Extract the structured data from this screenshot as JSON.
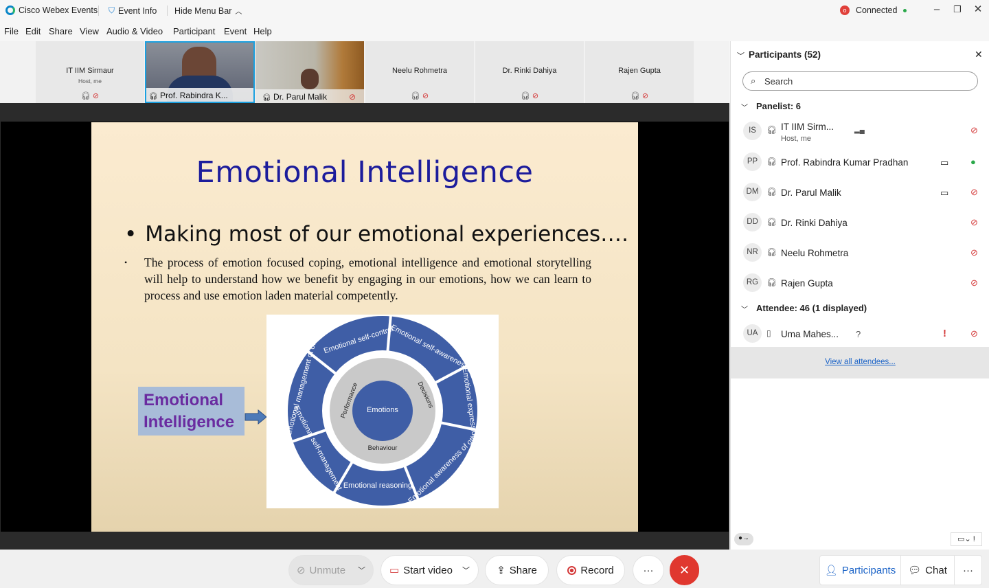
{
  "titlebar": {
    "app_name": "Cisco Webex Events",
    "event_info": "Event Info",
    "hide_menu": "Hide Menu Bar",
    "status": "Connected"
  },
  "menu": [
    "File",
    "Edit",
    "Share",
    "View",
    "Audio & Video",
    "Participant",
    "Event",
    "Help"
  ],
  "strip": {
    "tiles": [
      {
        "name": "IT IIM Sirmaur",
        "sub": "Host, me"
      },
      {
        "name": "Prof. Rabindra K..."
      },
      {
        "name": "Dr. Parul Malik"
      },
      {
        "name": "Neelu Rohmetra"
      },
      {
        "name": "Dr. Rinki Dahiya"
      },
      {
        "name": "Rajen Gupta"
      }
    ]
  },
  "slide": {
    "title": "Emotional Intelligence",
    "bullet1": "Making most of our emotional experiences….",
    "bullet2": "The process of emotion focused coping, emotional intelligence and emotional storytelling will help to understand how we benefit by engaging in our emotions, how we can learn to process and use emotion laden material competently.",
    "box_line1": "Emotional",
    "box_line2": "Intelligence",
    "diagram": {
      "center": "Emotions",
      "inner": [
        "Performance",
        "Decisions",
        "Behaviour"
      ],
      "segments": [
        "Emotional self-control",
        "Emotional self-awareness",
        "Emotional expression",
        "Emotional awareness of others",
        "Emotional reasoning",
        "Emotional self-management",
        "Emotional management of others"
      ]
    }
  },
  "panel": {
    "title": "Participants (52)",
    "search_placeholder": "Search",
    "panelist_header": "Panelist: 6",
    "panelists": [
      {
        "initials": "IS",
        "name": "IT IIM Sirm...",
        "sub": "Host, me"
      },
      {
        "initials": "PP",
        "name": "Prof. Rabindra Kumar Pradhan"
      },
      {
        "initials": "DM",
        "name": "Dr. Parul Malik"
      },
      {
        "initials": "DD",
        "name": "Dr. Rinki Dahiya"
      },
      {
        "initials": "NR",
        "name": "Neelu Rohmetra"
      },
      {
        "initials": "RG",
        "name": "Rajen Gupta"
      }
    ],
    "attendee_header": "Attendee: 46 (1 displayed)",
    "attendee": {
      "initials": "UA",
      "name": "Uma Mahes...",
      "q": "?"
    },
    "view_all": "View all attendees..."
  },
  "bottom": {
    "unmute": "Unmute",
    "start_video": "Start video",
    "share": "Share",
    "record": "Record",
    "more": "···",
    "participants": "Participants",
    "chat": "Chat",
    "overflow": "···"
  }
}
